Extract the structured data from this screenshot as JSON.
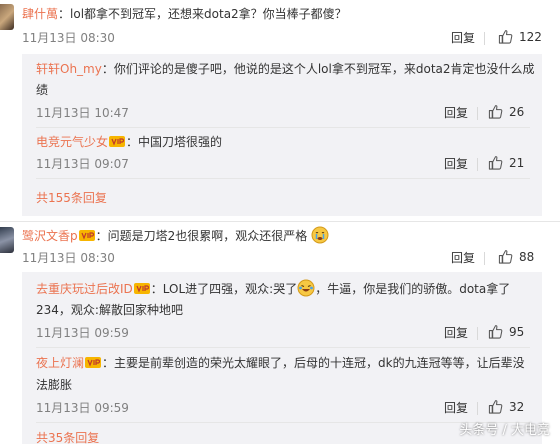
{
  "comments": [
    {
      "name": "肆什萬",
      "text": "：lol都拿不到冠军，还想来dota2拿？你当棒子都傻？",
      "time": "11月13日 08:30",
      "reply": "回复",
      "likes": "122",
      "subreplies": [
        {
          "name": "轩轩Oh_my",
          "text_line1": "：你们评论的是傻子吧，他说的是这个人lol拿不到冠军，来dota2肯定也没什么成",
          "text_line2": "绩",
          "time": "11月13日 10:47",
          "reply": "回复",
          "likes": "26"
        },
        {
          "name": "电竞元气少女",
          "text": "：中国刀塔很强的",
          "time": "11月13日 09:07",
          "reply": "回复",
          "likes": "21"
        }
      ],
      "more": "共155条回复"
    },
    {
      "name": "鹭沢文香p",
      "text": "：问题是刀塔2也很累啊，观众还很严格",
      "time": "11月13日 08:30",
      "reply": "回复",
      "likes": "88",
      "subreplies": [
        {
          "name": "去重庆玩过后改ID",
          "text_line1a": "：LOL进了四强，观众:哭了",
          "text_line1b": "，牛逼，你是我们的骄傲。dota拿了",
          "text_line2": "234，观众:解散回家种地吧",
          "time": "11月13日 09:59",
          "reply": "回复",
          "likes": "95"
        },
        {
          "name": "夜上灯澜",
          "text_line1": "：主要是前辈创造的荣光太耀眼了，后母的十连冠，dk的九连冠等等，让后辈没",
          "text_line2": "法膨胀",
          "time": "11月13日 09:59",
          "reply": "回复",
          "likes": "32"
        }
      ],
      "more": "共35条回复"
    }
  ],
  "watermark": "头条号 / 大电竞",
  "colors": {
    "name": "#eb7350",
    "meta": "#808080",
    "subbox_bg": "#f2f2f5"
  }
}
